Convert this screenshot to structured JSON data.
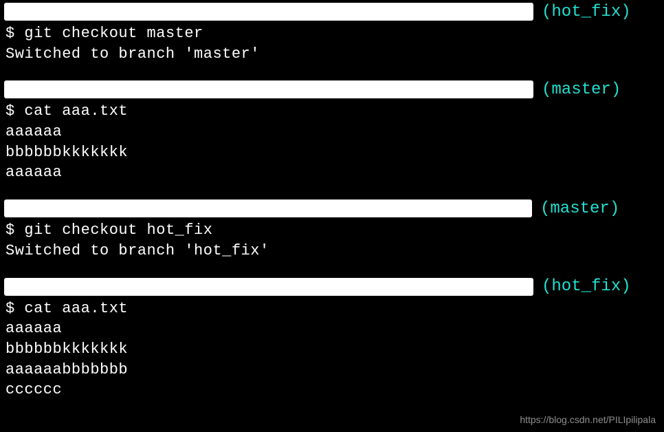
{
  "blocks": {
    "b1": {
      "branch": "(hot_fix)",
      "prompt": "$",
      "cmd": "git checkout master",
      "out1": "Switched to branch 'master'"
    },
    "b2": {
      "branch": "(master)",
      "prompt": "$",
      "cmd": "cat aaa.txt",
      "out1": "aaaaaa",
      "out2": "bbbbbbkkkkkkk",
      "out3": "aaaaaa"
    },
    "b3": {
      "branch": "(master)",
      "prompt": "$",
      "cmd": "git checkout hot_fix",
      "out1": "Switched to branch 'hot_fix'"
    },
    "b4": {
      "branch": "(hot_fix)",
      "prompt": "$",
      "cmd": "cat aaa.txt",
      "out1": "aaaaaa",
      "out2": "bbbbbbkkkkkkk",
      "out3": "aaaaaabbbbbbb",
      "out4": "cccccc"
    }
  },
  "watermark": "https://blog.csdn.net/PILIpilipala"
}
